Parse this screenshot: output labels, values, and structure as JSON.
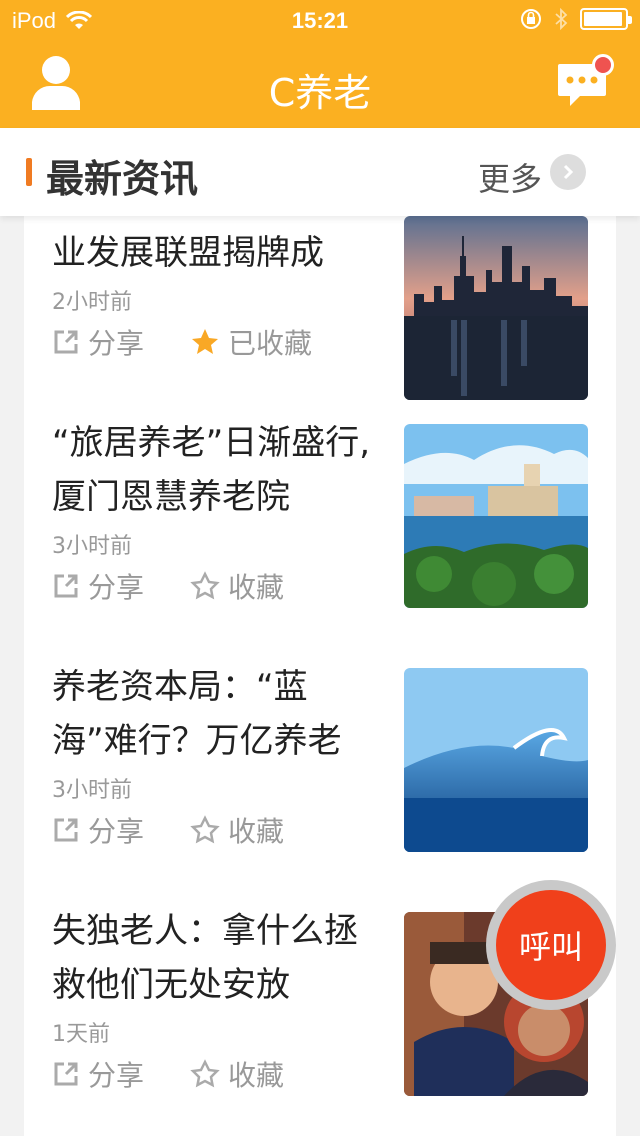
{
  "status": {
    "carrier": "iPod",
    "time": "15:21"
  },
  "header": {
    "title": "C养老"
  },
  "section": {
    "title": "最新资讯",
    "more": "更多"
  },
  "actions": {
    "share": "分享",
    "collect": "收藏",
    "collected": "已收藏"
  },
  "news": [
    {
      "title": "业发展联盟揭牌成",
      "time": "2小时前",
      "collected": true
    },
    {
      "title": "“旅居养老”日渐盛行,厦门恩慧养老院",
      "time": "3小时前",
      "collected": false
    },
    {
      "title": "养老资本局：“蓝海”难行？万亿养老",
      "time": "3小时前",
      "collected": false
    },
    {
      "title": "失独老人：拿什么拯救他们无处安放",
      "time": "1天前",
      "collected": false
    }
  ],
  "call_button": {
    "label": "呼叫"
  },
  "colors": {
    "brand": "#fbb021",
    "accent": "#f07b22",
    "call": "#f0401b",
    "star_active": "#f9a825"
  }
}
